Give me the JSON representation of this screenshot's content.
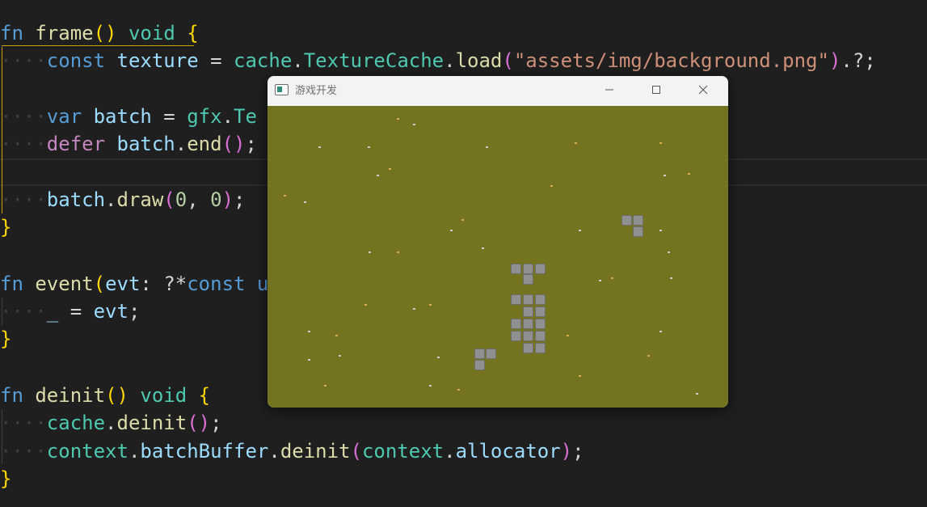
{
  "editor": {
    "lines": [
      [
        [
          "k-fn",
          "fn"
        ],
        [
          "k-punc",
          " "
        ],
        [
          "k-func",
          "frame"
        ],
        [
          "b1",
          "()"
        ],
        [
          "k-punc",
          " "
        ],
        [
          "k-type",
          "void"
        ],
        [
          "k-punc",
          " "
        ],
        [
          "b1",
          "{"
        ]
      ],
      [
        [
          "ws",
          "····"
        ],
        [
          "k-kw",
          "const"
        ],
        [
          "k-punc",
          " "
        ],
        [
          "k-var",
          "texture"
        ],
        [
          "k-punc",
          " = "
        ],
        [
          "k-type",
          "cache"
        ],
        [
          "k-punc",
          "."
        ],
        [
          "k-type",
          "TextureCache"
        ],
        [
          "k-punc",
          "."
        ],
        [
          "k-func",
          "load"
        ],
        [
          "b2",
          "("
        ],
        [
          "k-str",
          "\"assets/img/background.png\""
        ],
        [
          "b2",
          ")"
        ],
        [
          "k-punc",
          ".?;"
        ]
      ],
      [],
      [
        [
          "ws",
          "····"
        ],
        [
          "k-kw",
          "var"
        ],
        [
          "k-punc",
          " "
        ],
        [
          "k-var",
          "batch"
        ],
        [
          "k-punc",
          " = "
        ],
        [
          "k-type",
          "gfx"
        ],
        [
          "k-punc",
          "."
        ],
        [
          "k-type",
          "Te"
        ]
      ],
      [
        [
          "ws",
          "····"
        ],
        [
          "k-ctl",
          "defer"
        ],
        [
          "k-punc",
          " "
        ],
        [
          "k-var",
          "batch"
        ],
        [
          "k-punc",
          "."
        ],
        [
          "k-func",
          "end"
        ],
        [
          "b2",
          "()"
        ],
        [
          "k-punc",
          ";"
        ]
      ],
      [],
      [
        [
          "ws",
          "····"
        ],
        [
          "k-var",
          "batch"
        ],
        [
          "k-punc",
          "."
        ],
        [
          "k-func",
          "draw"
        ],
        [
          "b2",
          "("
        ],
        [
          "k-num",
          "0"
        ],
        [
          "k-punc",
          ", "
        ],
        [
          "k-num",
          "0"
        ],
        [
          "b2",
          ")"
        ],
        [
          "k-punc",
          ";"
        ]
      ],
      [
        [
          "b1",
          "}"
        ]
      ],
      [],
      [
        [
          "k-fn",
          "fn"
        ],
        [
          "k-punc",
          " "
        ],
        [
          "k-func",
          "event"
        ],
        [
          "b1",
          "("
        ],
        [
          "k-var",
          "evt"
        ],
        [
          "k-punc",
          ": ?*"
        ],
        [
          "k-kw",
          "const"
        ],
        [
          "k-punc",
          " "
        ],
        [
          "k-kw",
          "u"
        ]
      ],
      [
        [
          "ws",
          "····"
        ],
        [
          "k-var",
          "_"
        ],
        [
          "k-punc",
          " = "
        ],
        [
          "k-var",
          "evt"
        ],
        [
          "k-punc",
          ";"
        ]
      ],
      [
        [
          "b1",
          "}"
        ]
      ],
      [],
      [
        [
          "k-fn",
          "fn"
        ],
        [
          "k-punc",
          " "
        ],
        [
          "k-func",
          "deinit"
        ],
        [
          "b1",
          "()"
        ],
        [
          "k-punc",
          " "
        ],
        [
          "k-type",
          "void"
        ],
        [
          "k-punc",
          " "
        ],
        [
          "b1",
          "{"
        ]
      ],
      [
        [
          "ws",
          "····"
        ],
        [
          "k-type",
          "cache"
        ],
        [
          "k-punc",
          "."
        ],
        [
          "k-func",
          "deinit"
        ],
        [
          "b2",
          "()"
        ],
        [
          "k-punc",
          ";"
        ]
      ],
      [
        [
          "ws",
          "····"
        ],
        [
          "k-type",
          "context"
        ],
        [
          "k-punc",
          "."
        ],
        [
          "k-var",
          "batchBuffer"
        ],
        [
          "k-punc",
          "."
        ],
        [
          "k-func",
          "deinit"
        ],
        [
          "b2",
          "("
        ],
        [
          "k-type",
          "context"
        ],
        [
          "k-punc",
          "."
        ],
        [
          "k-var",
          "allocator"
        ],
        [
          "b2",
          ")"
        ],
        [
          "k-punc",
          ";"
        ]
      ],
      [
        [
          "b1",
          "}"
        ]
      ]
    ]
  },
  "game_window": {
    "title": "游戏开发",
    "icon": "app-window-icon",
    "buttons": {
      "minimize": "minimize-icon",
      "maximize": "maximize-icon",
      "close": "close-icon"
    },
    "background_color": "#747420",
    "tile_color": "#909090"
  }
}
